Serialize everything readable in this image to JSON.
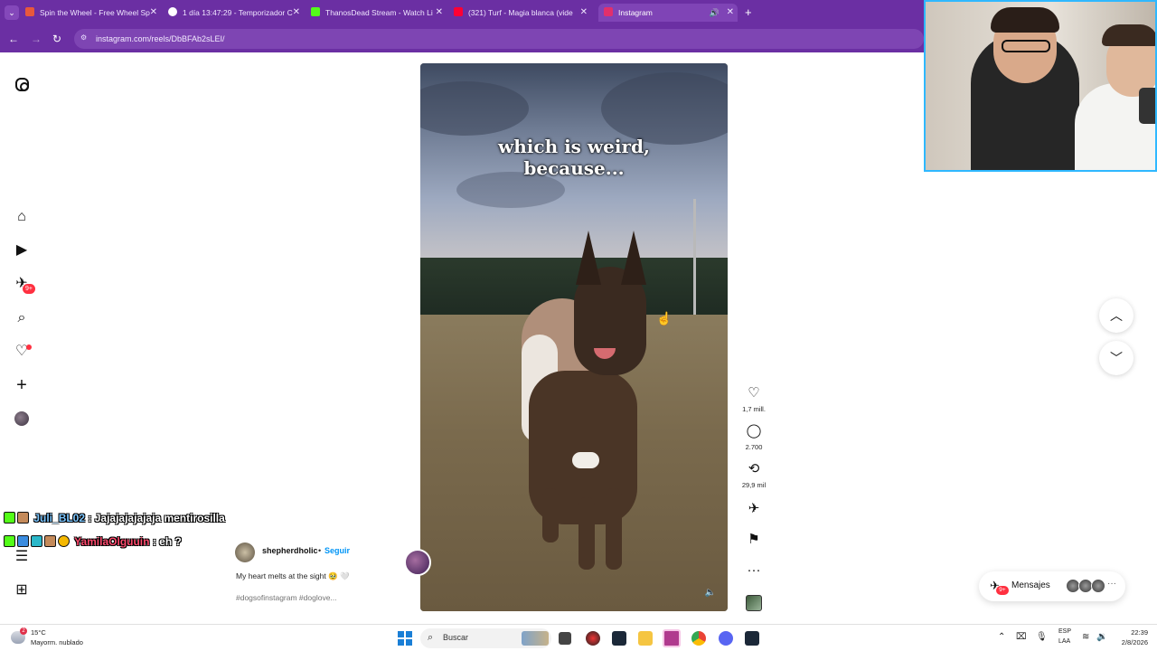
{
  "browser": {
    "tabs": [
      {
        "title": "Spin the Wheel - Free Wheel Sp",
        "favicon_color": "#e8583c"
      },
      {
        "title": "1 día 13:47:29 - Temporizador C",
        "favicon_color": "#ffffff"
      },
      {
        "title": "ThanosDead Stream - Watch Li",
        "favicon_color": "#53fc18"
      },
      {
        "title": "(321) Turf - Magia blanca (vide",
        "favicon_color": "#ff0033"
      },
      {
        "title": "Instagram",
        "favicon_color": "#e1306c",
        "active": true
      }
    ],
    "new_tab_label": "+",
    "url": "instagram.com/reels/DbBFAb2sLEI/"
  },
  "reel": {
    "caption_line1": "which is weird,",
    "caption_line2": "because..."
  },
  "actions": {
    "likes": "1,7 mill.",
    "comments": "2.700",
    "reposts": "29,9 mil"
  },
  "post": {
    "username": "shepherdholic",
    "separator": "•",
    "follow_label": "Seguir",
    "caption": "My heart melts at the sight 🥹 🤍",
    "hashtags": "#dogsofinstagram #doglove..."
  },
  "sidebar": {
    "badge_count": "9+"
  },
  "messages": {
    "label": "Mensajes",
    "badge": "9+",
    "more": "···"
  },
  "chat": [
    {
      "user": "Juli_BL02",
      "separator": ":",
      "message": "Jajajajajajaja mentirosilla"
    },
    {
      "user": "YamilaOlguuin",
      "separator": ":",
      "message": "eh ?"
    }
  ],
  "taskbar": {
    "weather_temp": "15°C",
    "weather_desc": "Mayorm. nublado",
    "weather_badge": "2",
    "search_label": "Buscar",
    "lang_line1": "ESP",
    "lang_line2": "LAA",
    "time": "22:39",
    "date": "2/8/2026"
  },
  "colors": {
    "browser_chrome": "#6b2fa3",
    "accent_link": "#0095f6",
    "notification_red": "#ff3040",
    "webcam_border": "#2fb8ff"
  }
}
